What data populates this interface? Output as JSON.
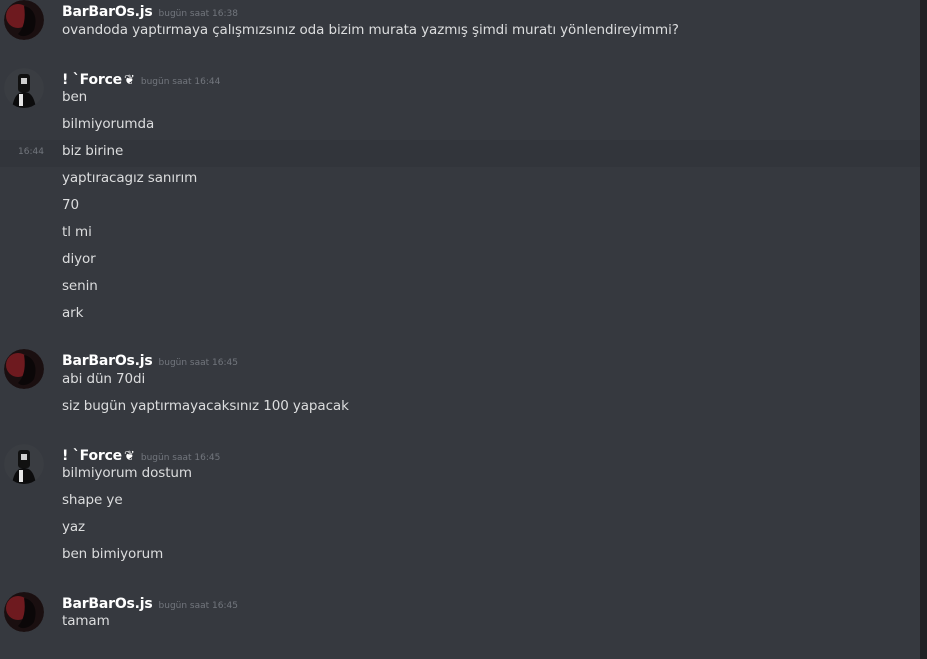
{
  "messages": [
    {
      "author": "BarBarOs.js",
      "badge": "",
      "timestamp": "bugün saat 16:38",
      "lines": [
        "ovandoda yaptırmaya çalışmızsınız oda bizim murata yazmış şimdi muratı yönlendireyimmi?"
      ]
    },
    {
      "author": "! `Force",
      "badge": "❦",
      "timestamp": "bugün saat 16:44",
      "lines": [
        "ben",
        "bilmiyorumda",
        "biz birine",
        "yaptıracagız sanırım",
        "70",
        "tl mi",
        "diyor",
        "senin",
        "ark"
      ],
      "hover_time": "16:44"
    },
    {
      "author": "BarBarOs.js",
      "badge": "",
      "timestamp": "bugün saat 16:45",
      "lines": [
        "abi dün 70di",
        "siz bugün yaptırmayacaksınız 100 yapacak"
      ]
    },
    {
      "author": "! `Force",
      "badge": "❦",
      "timestamp": "bugün saat 16:45",
      "lines": [
        "bilmiyorum dostum",
        "shape ye",
        "yaz",
        "ben bimiyorum"
      ]
    },
    {
      "author": "BarBarOs.js",
      "badge": "",
      "timestamp": "bugün saat 16:45",
      "lines": [
        "tamam"
      ]
    }
  ],
  "colors": {
    "background": "#36393f",
    "hover_background": "#32353b",
    "username": "#ffffff",
    "message_text": "#dcddde",
    "timestamp": "#72767d"
  }
}
